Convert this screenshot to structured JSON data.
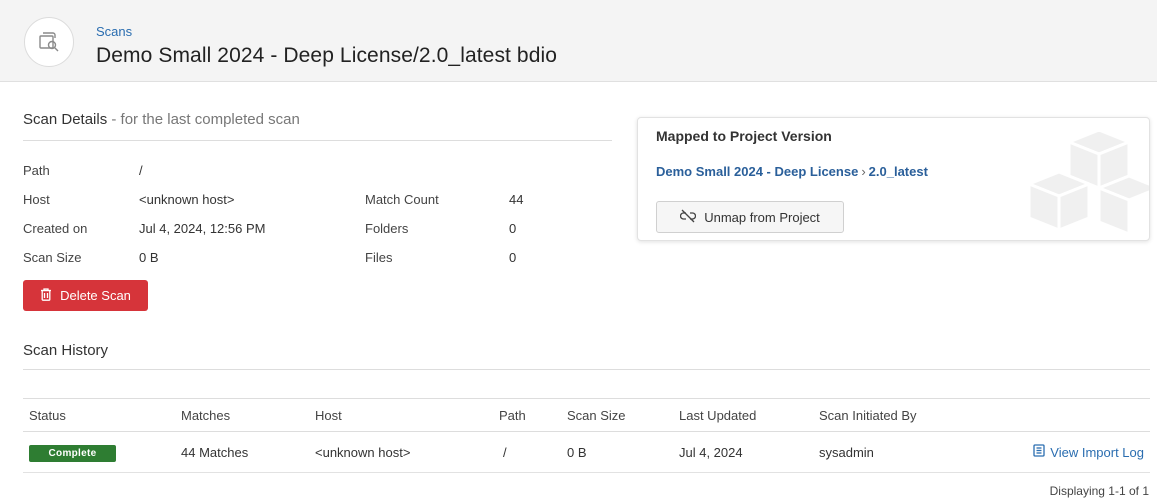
{
  "header": {
    "breadcrumb": "Scans",
    "title": "Demo Small 2024 - Deep License/2.0_latest bdio",
    "icon": "scan-search-icon"
  },
  "scan_details": {
    "title": "Scan Details",
    "subtitle": " - for the last completed scan",
    "left": [
      {
        "label": "Path",
        "value": "/"
      },
      {
        "label": "Host",
        "value": "<unknown host>"
      },
      {
        "label": "Created on",
        "value": "Jul 4, 2024, 12:56 PM"
      },
      {
        "label": "Scan Size",
        "value": "0 B"
      }
    ],
    "right": [
      {
        "label": "Match Count",
        "value": "44"
      },
      {
        "label": "Folders",
        "value": "0"
      },
      {
        "label": "Files",
        "value": "0"
      }
    ],
    "delete_label": "Delete Scan"
  },
  "mapped": {
    "title": "Mapped to Project Version",
    "project": "Demo Small 2024 - Deep License",
    "separator": "›",
    "version": "2.0_latest",
    "unmap_label": "Unmap from Project"
  },
  "history": {
    "title": "Scan History",
    "columns": [
      "Status",
      "Matches",
      "Host",
      "Path",
      "Scan Size",
      "Last Updated",
      "Scan Initiated By"
    ],
    "rows": [
      {
        "status": "Complete",
        "matches": "44 Matches",
        "host": "<unknown host>",
        "path": "/",
        "scan_size": "0 B",
        "last_updated": "Jul 4, 2024",
        "initiated_by": "sysadmin",
        "action": "View Import Log"
      }
    ],
    "pagination": "Displaying 1-1 of 1"
  },
  "colors": {
    "link": "#2a6db0",
    "danger": "#d6343a",
    "success": "#2e7d32"
  }
}
